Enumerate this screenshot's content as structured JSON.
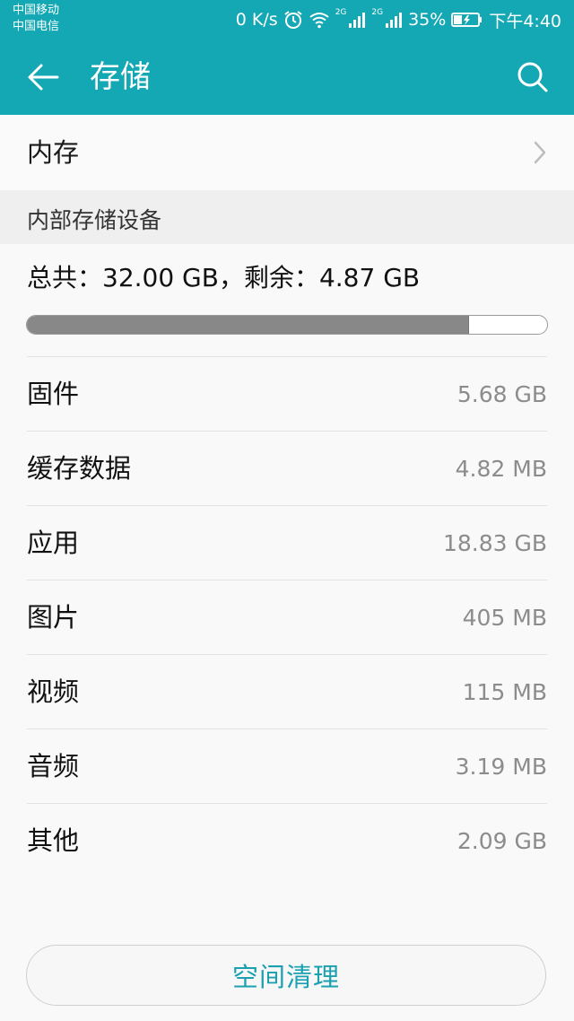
{
  "status_bar": {
    "carrier_1": "中国移动",
    "carrier_2": "中国电信",
    "net_speed": "0 K/s",
    "net_gen_1": "2G",
    "net_gen_2": "2G",
    "battery": "35%",
    "time": "下午4:40"
  },
  "header": {
    "title": "存储"
  },
  "memory": {
    "label": "内存"
  },
  "internal_storage": {
    "section_title": "内部存储设备",
    "summary": "总共：32.00 GB，剩余：4.87 GB",
    "used_fraction": 0.848
  },
  "categories": [
    {
      "name": "固件",
      "size": "5.68 GB"
    },
    {
      "name": "缓存数据",
      "size": "4.82 MB"
    },
    {
      "name": "应用",
      "size": "18.83 GB"
    },
    {
      "name": "图片",
      "size": "405 MB"
    },
    {
      "name": "视频",
      "size": "115 MB"
    },
    {
      "name": "音频",
      "size": "3.19 MB"
    },
    {
      "name": "其他",
      "size": "2.09 GB"
    }
  ],
  "actions": {
    "clean_label": "空间清理"
  },
  "colors": {
    "accent": "#14a8b4",
    "button_text": "#1aa0b0",
    "bar_fill": "#888888"
  }
}
